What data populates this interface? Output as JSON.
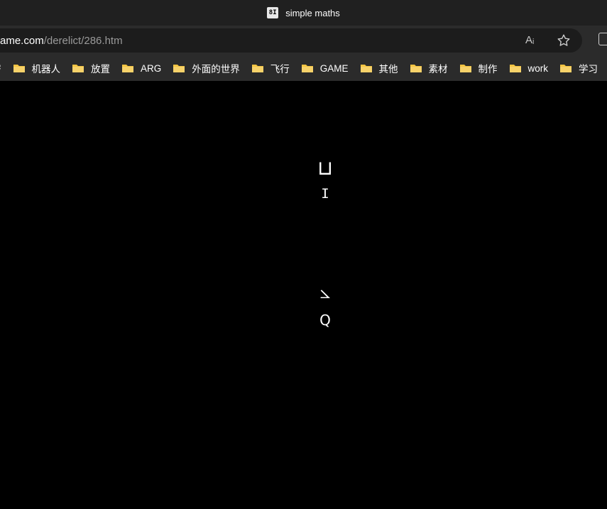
{
  "window": {
    "tab_title": "simple maths",
    "favicon_text": "8I"
  },
  "address_bar": {
    "url_host": "ame.com",
    "url_path": "/derelict/286.htm",
    "read_aloud_label": "Aᵢ"
  },
  "bookmarks": [
    {
      "label": "密"
    },
    {
      "label": "机器人"
    },
    {
      "label": "放置"
    },
    {
      "label": "ARG"
    },
    {
      "label": "外面的世界"
    },
    {
      "label": "飞行"
    },
    {
      "label": "GAME"
    },
    {
      "label": "其他"
    },
    {
      "label": "素材"
    },
    {
      "label": "制作"
    },
    {
      "label": "work"
    },
    {
      "label": "学习"
    }
  ],
  "puzzle": {
    "symbols": [
      "⊔",
      "I",
      "⦣",
      "Q"
    ]
  },
  "colors": {
    "titlebar": "#202020",
    "toolbar": "#2b2b2b",
    "page_background": "#000000",
    "folder": "#f4c542"
  }
}
